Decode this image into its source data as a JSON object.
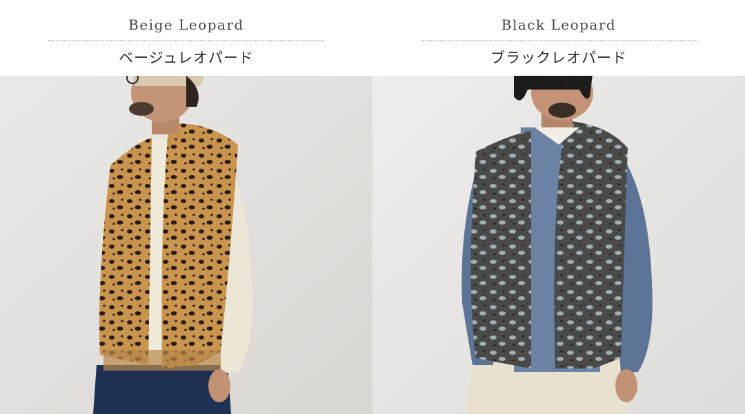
{
  "variants": [
    {
      "name_en": "Beige Leopard",
      "name_jp": "ベージュレオパード",
      "vest_color": "#c9944e",
      "spot_color": "#2a1c12",
      "backdrop": "#e6e4e1"
    },
    {
      "name_en": "Black Leopard",
      "name_jp": "ブラックレオパード",
      "vest_color": "#4a4a48",
      "spot_color": "#9fb0b4",
      "backdrop": "#e9e8e6"
    }
  ]
}
